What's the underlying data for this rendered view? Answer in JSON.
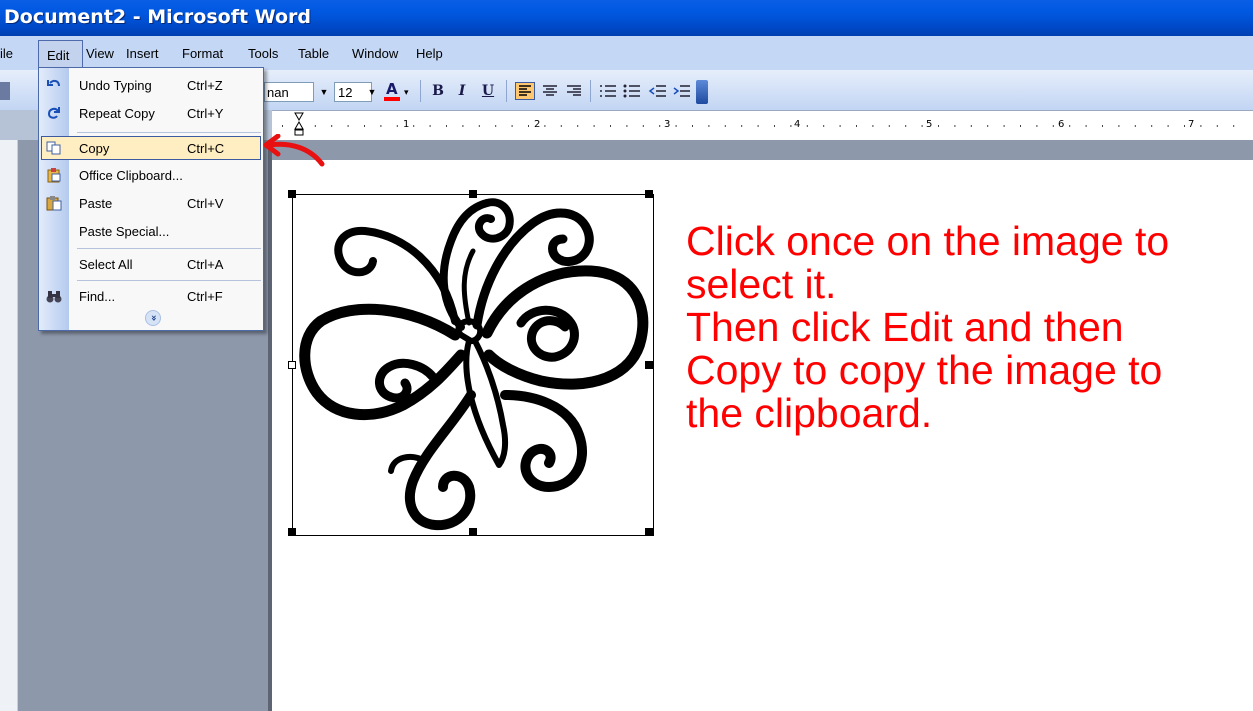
{
  "window": {
    "title": "Document2 - Microsoft Word"
  },
  "menubar": {
    "items": [
      {
        "id": "file",
        "label": "File",
        "display": "ile"
      },
      {
        "id": "edit",
        "label": "Edit"
      },
      {
        "id": "view",
        "label": "View"
      },
      {
        "id": "insert",
        "label": "Insert"
      },
      {
        "id": "format",
        "label": "Format"
      },
      {
        "id": "tools",
        "label": "Tools"
      },
      {
        "id": "table",
        "label": "Table"
      },
      {
        "id": "window",
        "label": "Window"
      },
      {
        "id": "help",
        "label": "Help"
      }
    ]
  },
  "toolbar": {
    "font_name": "nan",
    "font_size": "12",
    "bold": "B",
    "italic": "I",
    "underline": "U",
    "font_color_glyph": "A"
  },
  "ruler": {
    "numbers": [
      "1",
      "2",
      "3",
      "4",
      "5",
      "6",
      "7"
    ]
  },
  "edit_menu": {
    "items": [
      {
        "label": "Undo Typing",
        "shortcut": "Ctrl+Z",
        "icon": "undo-icon"
      },
      {
        "label": "Repeat Copy",
        "shortcut": "Ctrl+Y",
        "icon": "repeat-icon"
      },
      {
        "label": "Copy",
        "shortcut": "Ctrl+C",
        "icon": "copy-icon",
        "highlighted": true
      },
      {
        "label": "Office Clipboard...",
        "shortcut": "",
        "icon": "clipboard-icon"
      },
      {
        "label": "Paste",
        "shortcut": "Ctrl+V",
        "icon": "paste-icon"
      },
      {
        "label": "Paste Special...",
        "shortcut": ""
      },
      {
        "label": "Select All",
        "shortcut": "Ctrl+A"
      },
      {
        "label": "Find...",
        "shortcut": "Ctrl+F",
        "icon": "binoculars-icon"
      }
    ],
    "expand_glyph": "»"
  },
  "document": {
    "image": "butterfly line-art image (selected)",
    "instructions": [
      "Click once on the image to",
      "select it.",
      "Then click Edit and then",
      "Copy to copy the image to",
      "the clipboard."
    ]
  },
  "colors": {
    "titlebar": "#0058e0",
    "menu_highlight": "#ffeec2",
    "instruction_text": "#ff0000",
    "annotation_arrow": "#ff0000"
  }
}
